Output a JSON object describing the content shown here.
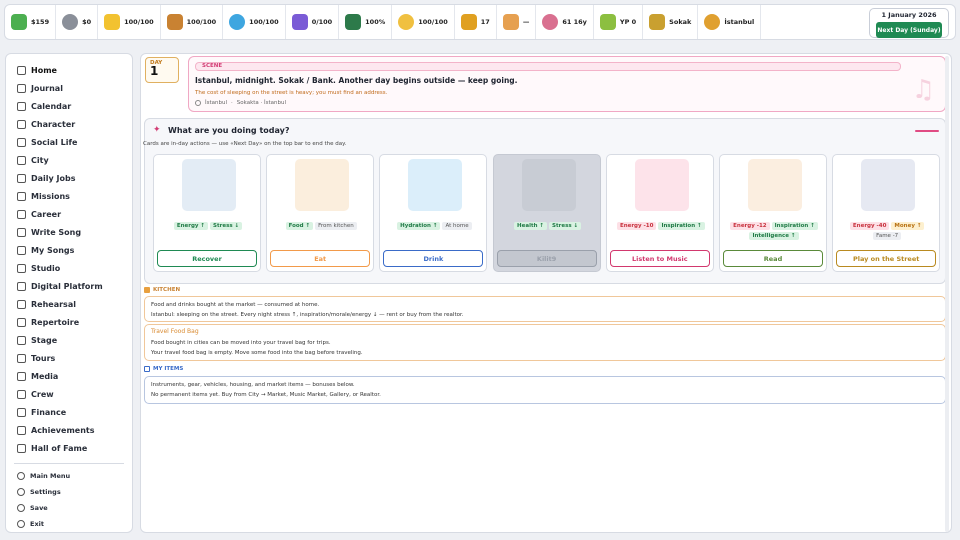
{
  "topbar": {
    "stats": [
      {
        "icon": "cash-icon",
        "value": "$159",
        "color": "#4caf50"
      },
      {
        "icon": "bank-icon",
        "value": "$0",
        "color": "#8a8f99"
      },
      {
        "icon": "energy-icon",
        "value": "100/100",
        "color": "#f2c230"
      },
      {
        "icon": "food-icon",
        "value": "100/100",
        "color": "#c98232"
      },
      {
        "icon": "water-drop-icon",
        "value": "100/100",
        "color": "#3ea6e0"
      },
      {
        "icon": "stress-icon",
        "value": "0/100",
        "color": "#7a5bd6"
      },
      {
        "icon": "health-heart-icon",
        "value": "100%",
        "color": "#2d7a4a"
      },
      {
        "icon": "inspiration-icon",
        "value": "100/100",
        "color": "#f0c040"
      },
      {
        "icon": "fame-star-icon",
        "value": "17",
        "color": "#e0a020"
      },
      {
        "icon": "music-box-icon",
        "value": "—",
        "color": "#e6a050"
      },
      {
        "icon": "age-icon",
        "value": "61 16y",
        "color": "#d97090"
      },
      {
        "icon": "yp-icon",
        "value": "YP 0",
        "color": "#8cbf40"
      },
      {
        "icon": "home-icon",
        "value": "Sokak",
        "color": "#c9a030"
      },
      {
        "icon": "city-icon",
        "value": "İstanbul",
        "color": "#e0a030"
      }
    ],
    "date": "1 January 2026",
    "next_day_label": "Next Day (Sunday)"
  },
  "sidebar": {
    "items": [
      "Home",
      "Journal",
      "Calendar",
      "Character",
      "Social Life",
      "City",
      "Daily Jobs",
      "Missions",
      "Career",
      "Write Song",
      "My Songs",
      "Studio",
      "Digital Platform",
      "Rehearsal",
      "Repertoire",
      "Stage",
      "Tours",
      "Media",
      "Crew",
      "Finance",
      "Achievements",
      "Hall of Fame"
    ],
    "bottom": [
      "Main Menu",
      "Settings",
      "Save",
      "Exit"
    ]
  },
  "main": {
    "day_label": "DAY",
    "day_number": "1",
    "scene": {
      "tag": "SCENE",
      "headline": "Istanbul, midnight. Sokak / Bank. Another day begins outside — keep going.",
      "warning": "The cost of sleeping on the street is heavy; you must find an address.",
      "location": "İstanbul",
      "location_sep": "·",
      "location_detail": "Sokakta · İstanbul"
    },
    "panel": {
      "title": "What are you doing today?",
      "subtitle": "Cards are in-day actions — use «Next Day» on the top bar to end the day."
    },
    "cards": [
      {
        "name": "recover",
        "chips": [
          {
            "t": "Energy ↑",
            "c": "g"
          },
          {
            "t": "Stress ↓",
            "c": "g"
          }
        ],
        "button": "Recover",
        "color": "#1f8a53",
        "img": "#e3ecf5",
        "disabled": false
      },
      {
        "name": "eat",
        "chips": [
          {
            "t": "Food ↑",
            "c": "g"
          },
          {
            "t": "From kitchen",
            "c": "n"
          }
        ],
        "button": "Eat",
        "color": "#f29a4a",
        "img": "#fbeedd",
        "disabled": false
      },
      {
        "name": "drink",
        "chips": [
          {
            "t": "Hydration ↑",
            "c": "g"
          },
          {
            "t": "At home",
            "c": "n"
          }
        ],
        "button": "Drink",
        "color": "#3a6bc8",
        "img": "#dbeefa",
        "disabled": false
      },
      {
        "name": "kilit",
        "chips": [
          {
            "t": "Health ↑",
            "c": "g"
          },
          {
            "t": "Stress ↓",
            "c": "g"
          }
        ],
        "button": "Kilit9",
        "color": "#9aa0ab",
        "img": "#c8ccd4",
        "disabled": true
      },
      {
        "name": "listen-to-music",
        "chips": [
          {
            "t": "Energy -10",
            "c": "r"
          },
          {
            "t": "Inspiration ↑",
            "c": "g"
          }
        ],
        "button": "Listen to Music",
        "color": "#d2386e",
        "img": "#fde3ea",
        "disabled": false
      },
      {
        "name": "read",
        "chips": [
          {
            "t": "Energy -12",
            "c": "r"
          },
          {
            "t": "Inspiration ↑",
            "c": "g"
          },
          {
            "t": "Intelligence ↑",
            "c": "g"
          }
        ],
        "button": "Read",
        "color": "#5a8a3a",
        "img": "#fbeee0",
        "disabled": false
      },
      {
        "name": "play-on-the-street",
        "chips": [
          {
            "t": "Energy -40",
            "c": "r"
          },
          {
            "t": "Money ↑",
            "c": "y"
          },
          {
            "t": "Fame -7",
            "c": "n"
          }
        ],
        "button": "Play on the Street",
        "color": "#b98a20",
        "img": "#e6e9f2",
        "disabled": false
      }
    ],
    "kitchen": {
      "heading": "KITCHEN",
      "line1": "Food and drinks bought at the market — consumed at home.",
      "line2": "Istanbul: sleeping on the street. Every night stress ↑, inspiration/morale/energy ↓ — rent or buy from the realtor.",
      "bag_title": "Travel Food Bag",
      "bag_line1": "Food bought in cities can be moved into your travel bag for trips.",
      "bag_line2": "Your travel food bag is empty. Move some food into the bag before traveling."
    },
    "items": {
      "heading": "MY ITEMS",
      "line1": "Instruments, gear, vehicles, housing, and market items — bonuses below.",
      "line2": "No permanent items yet. Buy from City → Market, Music Market, Gallery, or Realtor."
    }
  }
}
